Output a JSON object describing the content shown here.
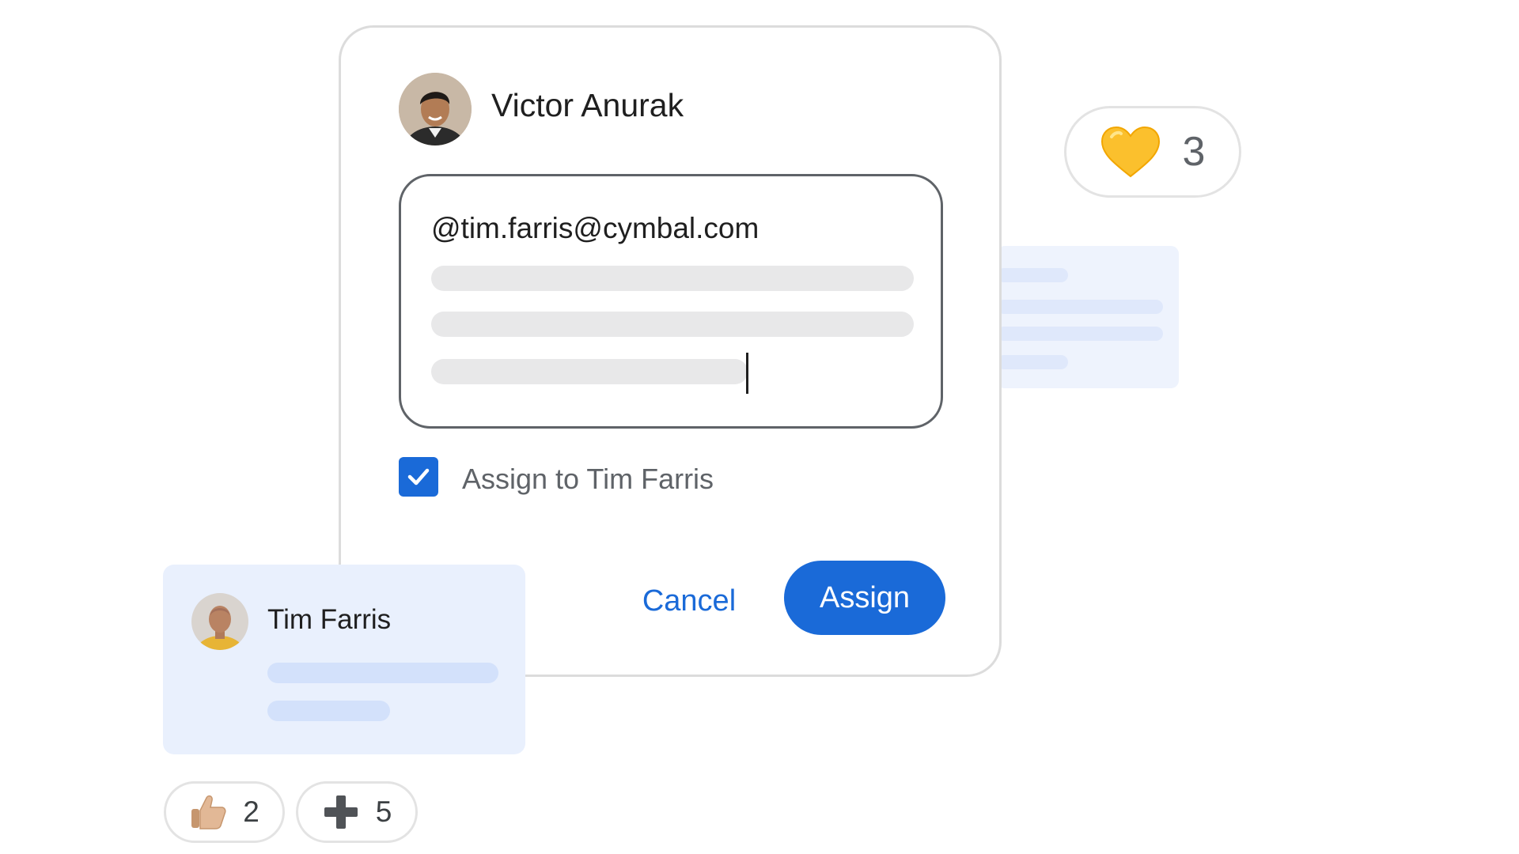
{
  "dialog": {
    "author": {
      "name": "Victor Anurak",
      "avatar_icon": "person-avatar"
    },
    "comment": {
      "mention": "@tim.farris@cymbal.com",
      "placeholder_lines": 3
    },
    "assign_checkbox": {
      "checked": true,
      "label": "Assign to Tim Farris"
    },
    "buttons": {
      "cancel": "Cancel",
      "assign": "Assign"
    }
  },
  "assignee_card": {
    "name": "Tim Farris",
    "avatar_icon": "person-avatar"
  },
  "reactions": {
    "heart": {
      "icon": "yellow-heart-icon",
      "count": "3"
    },
    "thumbs_up": {
      "icon": "thumbs-up-icon",
      "count": "2"
    },
    "plus": {
      "icon": "plus-icon",
      "count": "5"
    }
  },
  "colors": {
    "accent": "#1a6ad8",
    "card_blue": "#e9f0fd",
    "heart_yellow": "#fbc02d"
  }
}
